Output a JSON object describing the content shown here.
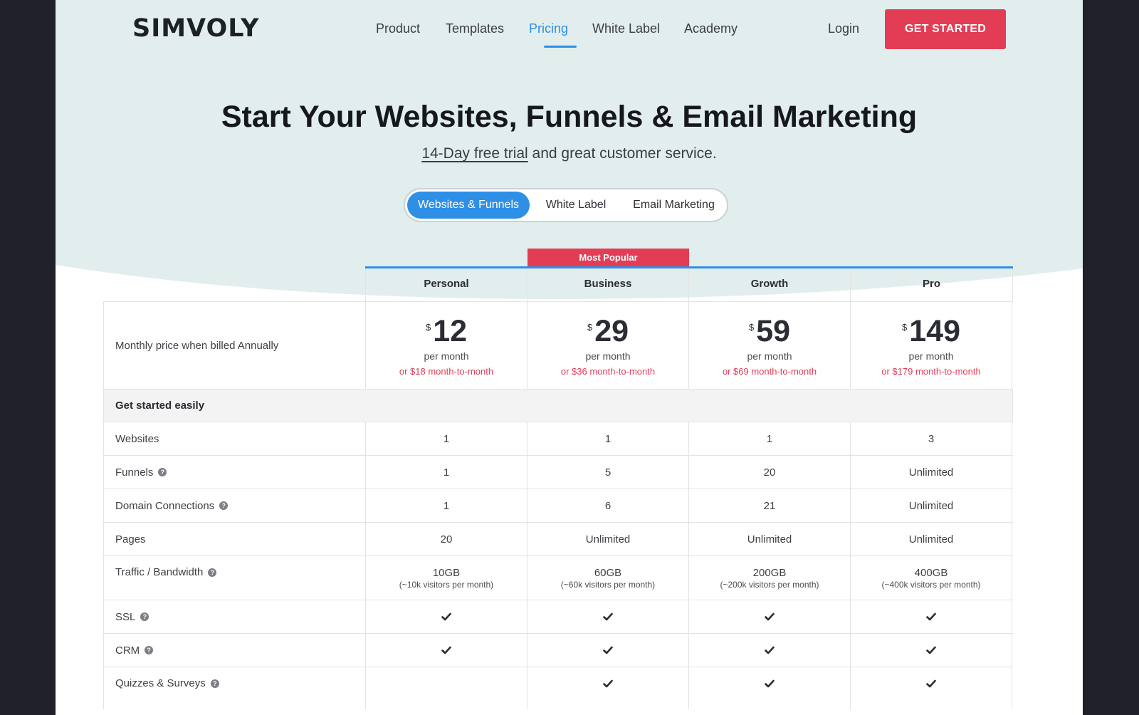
{
  "header": {
    "logo": "SIMVOLY",
    "nav": [
      {
        "label": "Product",
        "active": false
      },
      {
        "label": "Templates",
        "active": false
      },
      {
        "label": "Pricing",
        "active": true
      },
      {
        "label": "White Label",
        "active": false
      },
      {
        "label": "Academy",
        "active": false
      }
    ],
    "login": "Login",
    "cta": "GET STARTED"
  },
  "hero": {
    "title": "Start Your Websites, Funnels & Email Marketing",
    "subtitle_link": "14-Day free trial",
    "subtitle_rest": " and great customer service."
  },
  "toggle": {
    "options": [
      "Websites & Funnels",
      "White Label",
      "Email Marketing"
    ],
    "active": "Websites & Funnels"
  },
  "table": {
    "badge": "Most Popular",
    "plans": [
      "Personal",
      "Business",
      "Growth",
      "Pro"
    ],
    "price_row": {
      "label": "Monthly price when billed Annually",
      "currency": "$",
      "per": "per month",
      "prices": [
        "12",
        "29",
        "59",
        "149"
      ],
      "month_to_month": [
        "or $18 month-to-month",
        "or $36 month-to-month",
        "or $69 month-to-month",
        "or $179 month-to-month"
      ]
    },
    "section": "Get started easily",
    "rows": [
      {
        "label": "Websites",
        "help": false,
        "values": [
          "1",
          "1",
          "1",
          "3"
        ]
      },
      {
        "label": "Funnels",
        "help": true,
        "values": [
          "1",
          "5",
          "20",
          "Unlimited"
        ]
      },
      {
        "label": "Domain Connections",
        "help": true,
        "values": [
          "1",
          "6",
          "21",
          "Unlimited"
        ]
      },
      {
        "label": "Pages",
        "help": false,
        "values": [
          "20",
          "Unlimited",
          "Unlimited",
          "Unlimited"
        ]
      },
      {
        "label": "Traffic / Bandwidth",
        "help": true,
        "values": [
          "10GB",
          "60GB",
          "200GB",
          "400GB"
        ],
        "subs": [
          "(~10k visitors per month)",
          "(~60k visitors per month)",
          "(~200k visitors per month)",
          "(~400k visitors per month)"
        ]
      },
      {
        "label": "SSL",
        "help": true,
        "checks": [
          true,
          true,
          true,
          true
        ]
      },
      {
        "label": "CRM",
        "help": true,
        "checks": [
          true,
          true,
          true,
          true
        ]
      },
      {
        "label": "Quizzes & Surveys",
        "help": true,
        "checks": [
          false,
          true,
          true,
          true
        ]
      }
    ]
  },
  "colors": {
    "accent_blue": "#2d8fe6",
    "accent_red": "#e33d56",
    "hero_bg": "#e2eeee",
    "frame": "#1f2029"
  }
}
